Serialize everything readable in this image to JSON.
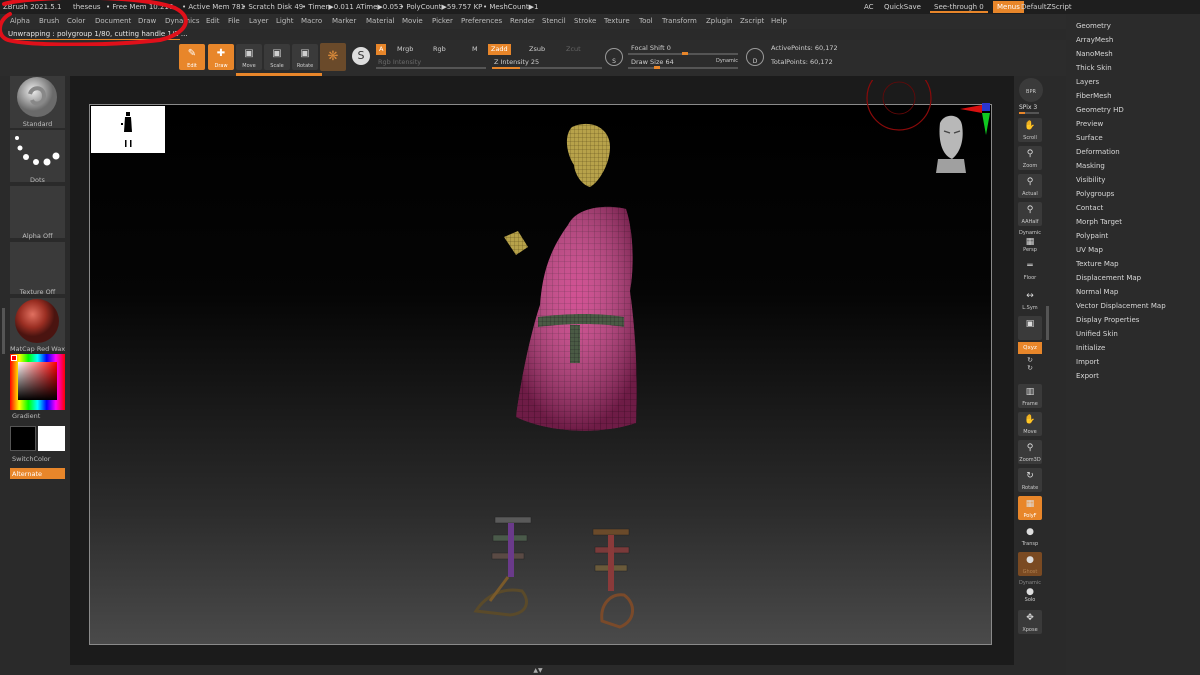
{
  "titlebar": {
    "app": "ZBrush 2021.5.1",
    "project": "theseus",
    "free_mem": "• Free Mem 10.216",
    "active_mem": "• Active Mem 781",
    "scratch_disk": "• Scratch Disk 49",
    "timer": "• Timer▶0.011 ATime▶0.053",
    "polycount": "• PolyCount▶59.757 KP",
    "meshcount": "• MeshCount▶1",
    "ac": "AC",
    "quicksave": "QuickSave",
    "seethrough": "See-through   0",
    "menus": "Menus",
    "zscript": "DefaultZScript"
  },
  "menubar": [
    "Alpha",
    "Brush",
    "Color",
    "Document",
    "Draw",
    "Dynamics",
    "Edit",
    "File",
    "Layer",
    "Light",
    "Macro",
    "Marker",
    "Material",
    "Movie",
    "Picker",
    "Preferences",
    "Render",
    "Stencil",
    "Stroke",
    "Texture",
    "Tool",
    "Transform",
    "Zplugin",
    "Zscript",
    "Help"
  ],
  "notification": "Unwrapping : polygroup 1/80, cutting handle 1/1 ...",
  "shelf": {
    "edit": "Edit",
    "draw": "Draw",
    "move": "Move",
    "scale": "Scale",
    "rotate": "Rotate",
    "a": "A",
    "mrgb": "Mrgb",
    "rgb": "Rgb",
    "m": "M",
    "zadd": "Zadd",
    "zsub": "Zsub",
    "zcut": "Zcut",
    "rgb_intensity": "Rgb Intensity",
    "z_intensity": "Z Intensity 25",
    "z_intensity_value": 25,
    "focal_shift": "Focal Shift 0",
    "draw_size": "Draw Size 64",
    "draw_size_value": 64,
    "dynamic": "Dynamic",
    "active_points": "ActivePoints: 60,172",
    "total_points": "TotalPoints: 60,172"
  },
  "leftshelf": {
    "brush": "Standard",
    "stroke": "Dots",
    "alpha": "Alpha Off",
    "texture": "Texture Off",
    "material": "MatCap Red Wax",
    "gradient": "Gradient",
    "switchcolor": "SwitchColor",
    "alternate": "Alternate"
  },
  "rightshelf": {
    "bpr": "BPR",
    "spix": "SPix 3",
    "scroll": "Scroll",
    "zoom": "Zoom",
    "actual": "Actual",
    "aahalf": "AAHalf",
    "dynamic": "Dynamic",
    "persp": "Persp",
    "floor": "Floor",
    "lsym": "L.Sym",
    "xyz": "Qxyz",
    "frame": "Frame",
    "move": "Move",
    "zoom3d": "Zoom3D",
    "rotate": "Rotate",
    "polyf": "PolyF",
    "transp": "Transp",
    "ghost": "Ghost",
    "dynamic2": "Dynamic",
    "solo": "Solo",
    "xpose": "Xpose"
  },
  "tray": [
    "Geometry",
    "ArrayMesh",
    "NanoMesh",
    "Thick Skin",
    "Layers",
    "FiberMesh",
    "Geometry HD",
    "Preview",
    "Surface",
    "Deformation",
    "Masking",
    "Visibility",
    "Polygroups",
    "Contact",
    "Morph Target",
    "Polypaint",
    "UV Map",
    "Texture Map",
    "Displacement Map",
    "Normal Map",
    "Vector Displacement Map",
    "Display Properties",
    "Unified Skin",
    "Initialize",
    "Import",
    "Export"
  ],
  "colors": {
    "accent": "#e8862a",
    "annotation": "#e0101a",
    "robe": "#c8327f"
  }
}
